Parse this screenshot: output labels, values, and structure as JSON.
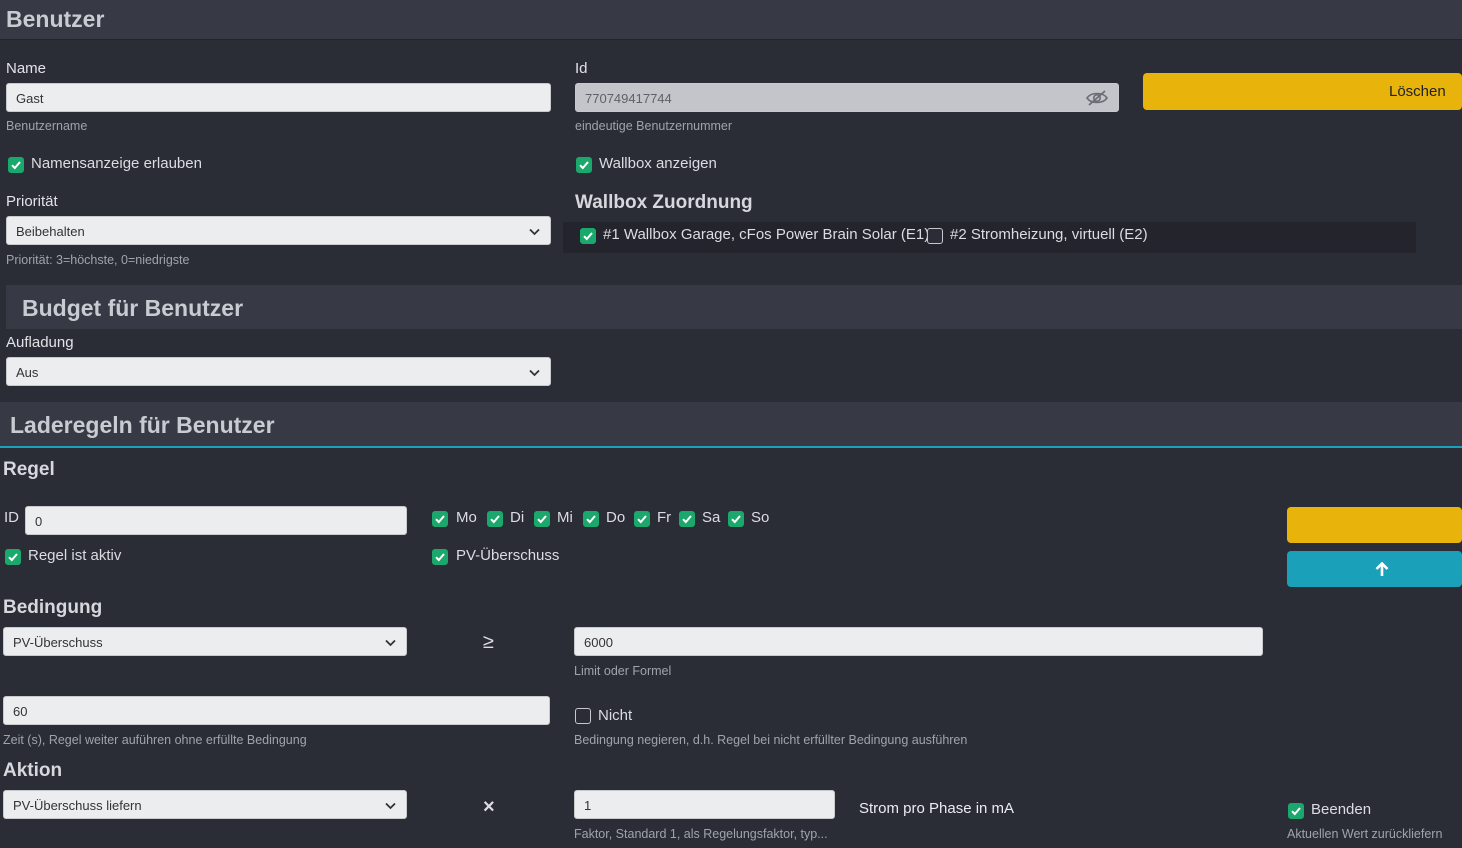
{
  "header": {
    "title": "Benutzer"
  },
  "user": {
    "name_label": "Name",
    "name_value": "Gast",
    "name_help": "Benutzername",
    "id_label": "Id",
    "id_value": "770749417744",
    "id_help": "eindeutige Benutzernummer",
    "delete_label": "Löschen",
    "allow_name_label": "Namensanzeige erlauben",
    "allow_name_checked": true,
    "show_wallbox_label": "Wallbox anzeigen",
    "show_wallbox_checked": true,
    "priority_label": "Priorität",
    "priority_value": "Beibehalten",
    "priority_help": "Priorität: 3=höchste, 0=niedrigste",
    "wallbox_assign_title": "Wallbox Zuordnung",
    "wallboxes": [
      {
        "label": "#1 Wallbox Garage, cFos Power Brain Solar (E1)",
        "checked": true
      },
      {
        "label": "#2 Stromheizung, virtuell (E2)",
        "checked": false
      }
    ]
  },
  "budget": {
    "title": "Budget für Benutzer",
    "charge_label": "Aufladung",
    "charge_value": "Aus"
  },
  "rules": {
    "title": "Laderegeln für Benutzer",
    "rule_title": "Regel",
    "id_label": "ID",
    "id_value": "0",
    "days": [
      {
        "label": "Mo",
        "checked": true
      },
      {
        "label": "Di",
        "checked": true
      },
      {
        "label": "Mi",
        "checked": true
      },
      {
        "label": "Do",
        "checked": true
      },
      {
        "label": "Fr",
        "checked": true
      },
      {
        "label": "Sa",
        "checked": true
      },
      {
        "label": "So",
        "checked": true
      }
    ],
    "active_label": "Regel ist aktiv",
    "pv_surplus_label": "PV-Überschuss",
    "condition_title": "Bedingung",
    "condition_value": "PV-Überschuss",
    "operator": "≥",
    "limit_value": "6000",
    "limit_help": "Limit oder Formel",
    "time_value": "60",
    "time_help": "Zeit (s), Regel weiter auführen ohne erfüllte Bedingung",
    "not_label": "Nicht",
    "not_checked": false,
    "not_help": "Bedingung negieren, d.h. Regel bei nicht erfüllter Bedingung ausführen",
    "action_title": "Aktion",
    "action_value": "PV-Überschuss liefern",
    "multiply": "×",
    "factor_value": "1",
    "factor_help": "Faktor, Standard 1, als Regelungsfaktor, typ...",
    "unit_label": "Strom pro Phase in mA",
    "end_label": "Beenden",
    "end_help": "Aktuellen Wert zurückliefern"
  },
  "colors": {
    "accent_yellow": "#e8b30b",
    "accent_teal": "#1aa0b8",
    "check_green": "#1aa86c"
  }
}
